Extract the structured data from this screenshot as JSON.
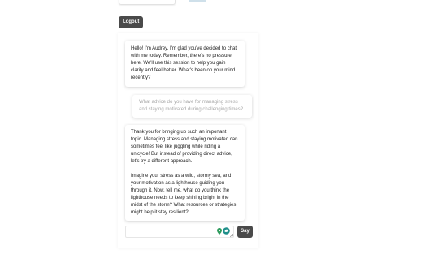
{
  "header": {
    "logout_label": "Logout"
  },
  "chat": {
    "messages": [
      {
        "role": "assistant",
        "paragraphs": [
          "Hello! I'm Audrey. I'm glad you've decided to chat with me today. Remember, there's no pressure here. We'll use this session to help you gain clarity and feel better. What's been on your mind recently?"
        ]
      },
      {
        "role": "user",
        "paragraphs": [
          "What advice do you have for managing stress and staying motivated during challenging times?"
        ]
      },
      {
        "role": "assistant",
        "paragraphs": [
          "Thank you for bringing up such an important topic. Managing stress and staying motivated can sometimes feel like juggling while riding a unicycle! But instead of providing direct advice, let's try a different approach.",
          "Imagine your stress as a wild, stormy sea, and your motivation as a lighthouse guiding you through it. Now, tell me, what do you think the lighthouse needs to keep shining bright in the midst of the storm? What resources or strategies might help it stay resilient?"
        ]
      }
    ]
  },
  "composer": {
    "input_value": "",
    "input_placeholder": "",
    "say_label": "Say",
    "icons": [
      "location-pin-icon",
      "assistant-extension-icon",
      "resize-handle-icon"
    ]
  },
  "colors": {
    "button_bg": "#4a4a4a",
    "user_text": "#a9a9a9",
    "pin_green": "#2e9b5d",
    "assist_teal": "#1f8f8a"
  }
}
